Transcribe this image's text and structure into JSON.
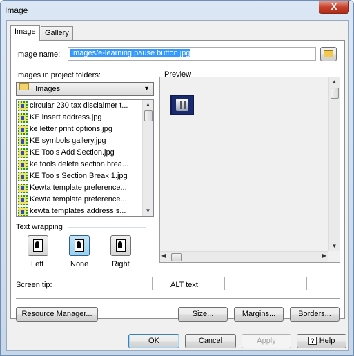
{
  "window": {
    "title": "Image",
    "close_glyph": "X"
  },
  "tabs": [
    {
      "label": "Image"
    },
    {
      "label": "Gallery"
    }
  ],
  "image_name": {
    "label": "Image name:",
    "value": "Images/e-learning pause button.jpg",
    "browse_icon": "folder-open-icon"
  },
  "folders": {
    "label": "Images in project folders:",
    "selected": "Images",
    "items": [
      "circular 230 tax disclaimer t...",
      "KE insert address.jpg",
      "ke letter print options.jpg",
      "KE symbols gallery.jpg",
      "KE Tools Add Section.jpg",
      "ke tools delete section brea...",
      "KE Tools Section Break 1.jpg",
      "Kewta template preference...",
      "Kewta template preference...",
      "kewta templates address s..."
    ]
  },
  "preview": {
    "label": "Preview"
  },
  "text_wrapping": {
    "label": "Text wrapping",
    "options": [
      {
        "label": "Left"
      },
      {
        "label": "None"
      },
      {
        "label": "Right"
      }
    ],
    "selected": "None"
  },
  "screen_tip": {
    "label": "Screen tip:",
    "value": ""
  },
  "alt_text": {
    "label": "ALT text:",
    "value": ""
  },
  "actions": {
    "resource_manager": "Resource Manager...",
    "size": "Size...",
    "margins": "Margins...",
    "borders": "Borders..."
  },
  "footer": {
    "ok": "OK",
    "cancel": "Cancel",
    "apply": "Apply",
    "help": "Help",
    "help_icon_glyph": "?"
  }
}
